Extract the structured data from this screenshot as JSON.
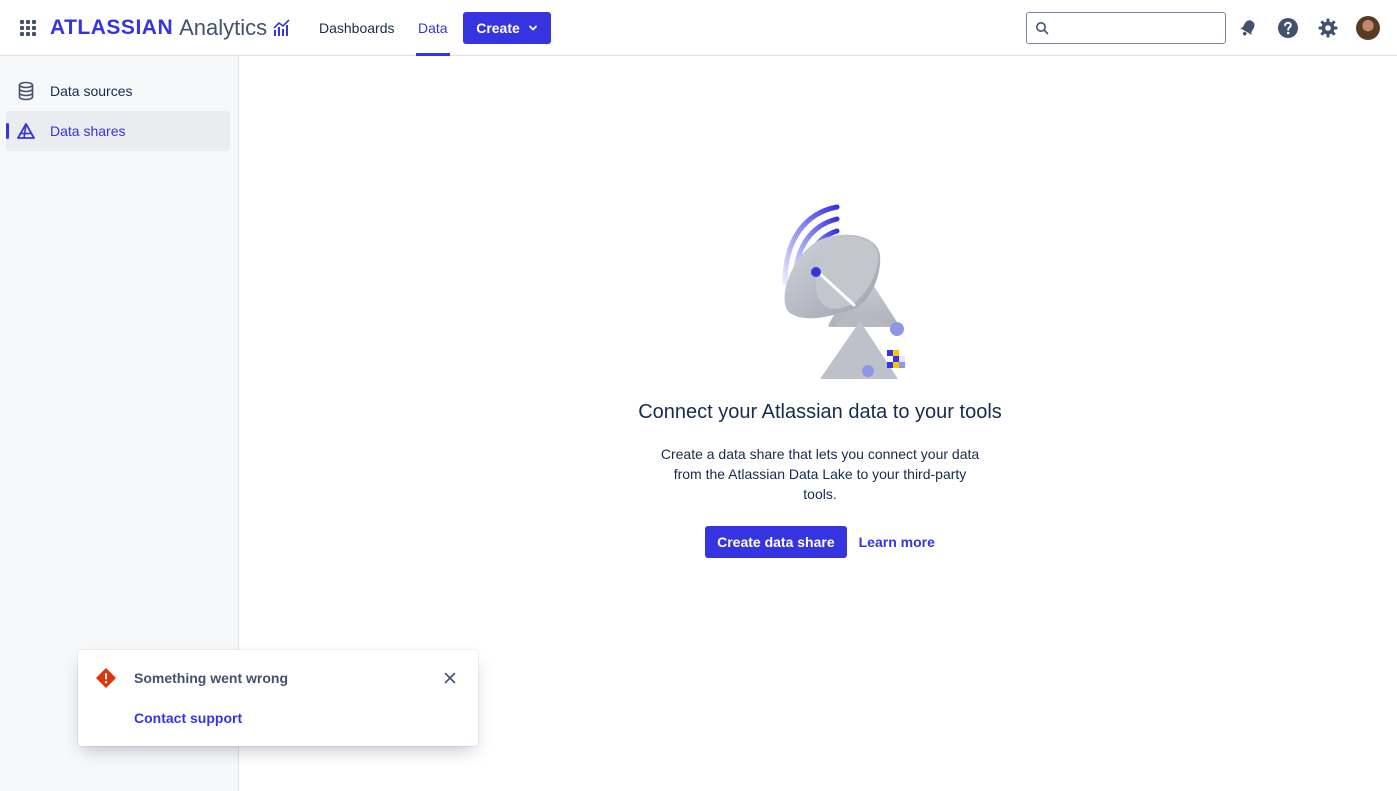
{
  "header": {
    "brand": "ATLASSIAN",
    "product": "Analytics",
    "nav": {
      "dashboards": "Dashboards",
      "data": "Data"
    },
    "create_label": "Create",
    "search": {
      "placeholder": ""
    }
  },
  "sidebar": {
    "items": [
      {
        "label": "Data sources",
        "icon": "database-icon"
      },
      {
        "label": "Data shares",
        "icon": "data-share-icon"
      }
    ]
  },
  "main": {
    "title": "Connect your Atlassian data to your tools",
    "description": "Create a data share that lets you connect your data from the Atlassian Data Lake to your third-party tools.",
    "primary_action": "Create data share",
    "secondary_action": "Learn more"
  },
  "flag": {
    "title": "Something went wrong",
    "link": "Contact support",
    "icon": "error-icon"
  },
  "colors": {
    "accent": "#3634e0",
    "error": "#de350b",
    "text": "#172b4d"
  }
}
